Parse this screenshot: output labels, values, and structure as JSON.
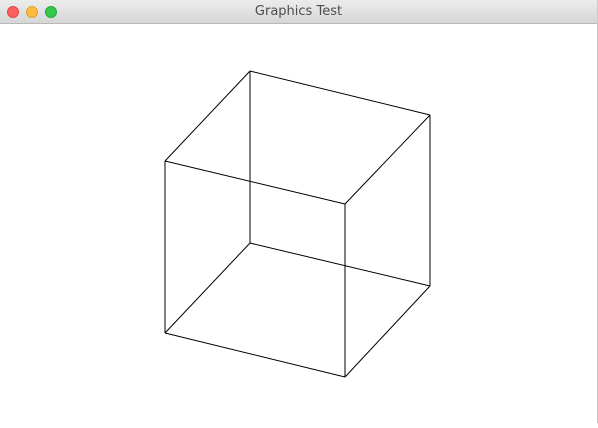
{
  "window": {
    "title": "Graphics Test",
    "controls": {
      "close_color": "#fc605c",
      "minimize_color": "#fdbc40",
      "zoom_color": "#34c84a"
    }
  },
  "canvas": {
    "background": "#ffffff",
    "line_color": "#000000",
    "shape": "wireframe-cube"
  }
}
